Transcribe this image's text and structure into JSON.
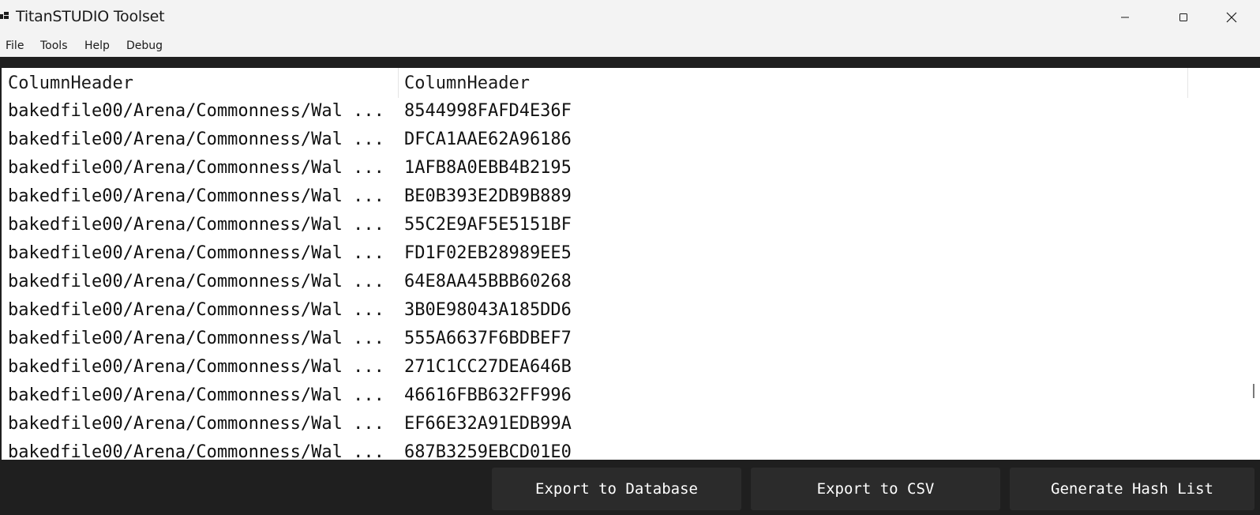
{
  "window": {
    "title": "TitanSTUDIO Toolset",
    "controls": {
      "minimize_icon": "minimize-icon",
      "maximize_icon": "maximize-icon",
      "close_icon": "close-icon"
    }
  },
  "menu": {
    "items": [
      "File",
      "Tools",
      "Help",
      "Debug"
    ]
  },
  "list": {
    "columns": [
      "ColumnHeader",
      "ColumnHeader"
    ],
    "rows": [
      {
        "path": "bakedfile00/Arena/Commonness/Wal ...",
        "hash": "8544998FAFD4E36F"
      },
      {
        "path": "bakedfile00/Arena/Commonness/Wal ...",
        "hash": "DFCA1AAE62A96186"
      },
      {
        "path": "bakedfile00/Arena/Commonness/Wal ...",
        "hash": "1AFB8A0EBB4B2195"
      },
      {
        "path": "bakedfile00/Arena/Commonness/Wal ...",
        "hash": "BE0B393E2DB9B889"
      },
      {
        "path": "bakedfile00/Arena/Commonness/Wal ...",
        "hash": "55C2E9AF5E5151BF"
      },
      {
        "path": "bakedfile00/Arena/Commonness/Wal ...",
        "hash": "FD1F02EB28989EE5"
      },
      {
        "path": "bakedfile00/Arena/Commonness/Wal ...",
        "hash": "64E8AA45BBB60268"
      },
      {
        "path": "bakedfile00/Arena/Commonness/Wal ...",
        "hash": "3B0E98043A185DD6"
      },
      {
        "path": "bakedfile00/Arena/Commonness/Wal ...",
        "hash": "555A6637F6BDBEF7"
      },
      {
        "path": "bakedfile00/Arena/Commonness/Wal ...",
        "hash": "271C1CC27DEA646B"
      },
      {
        "path": "bakedfile00/Arena/Commonness/Wal ...",
        "hash": "46616FBB632FF996"
      },
      {
        "path": "bakedfile00/Arena/Commonness/Wal ...",
        "hash": "EF66E32A91EDB99A"
      },
      {
        "path": "bakedfile00/Arena/Commonness/Wal ...",
        "hash": "687B3259EBCD01E0"
      }
    ]
  },
  "actions": {
    "export_database": "Export to Database",
    "export_csv": "Export to CSV",
    "generate_hash_list": "Generate Hash List"
  },
  "colors": {
    "dark_panel": "#1f1f1f",
    "button_bg": "#2b2b2b",
    "titlebar_bg": "#f3f3f3"
  }
}
